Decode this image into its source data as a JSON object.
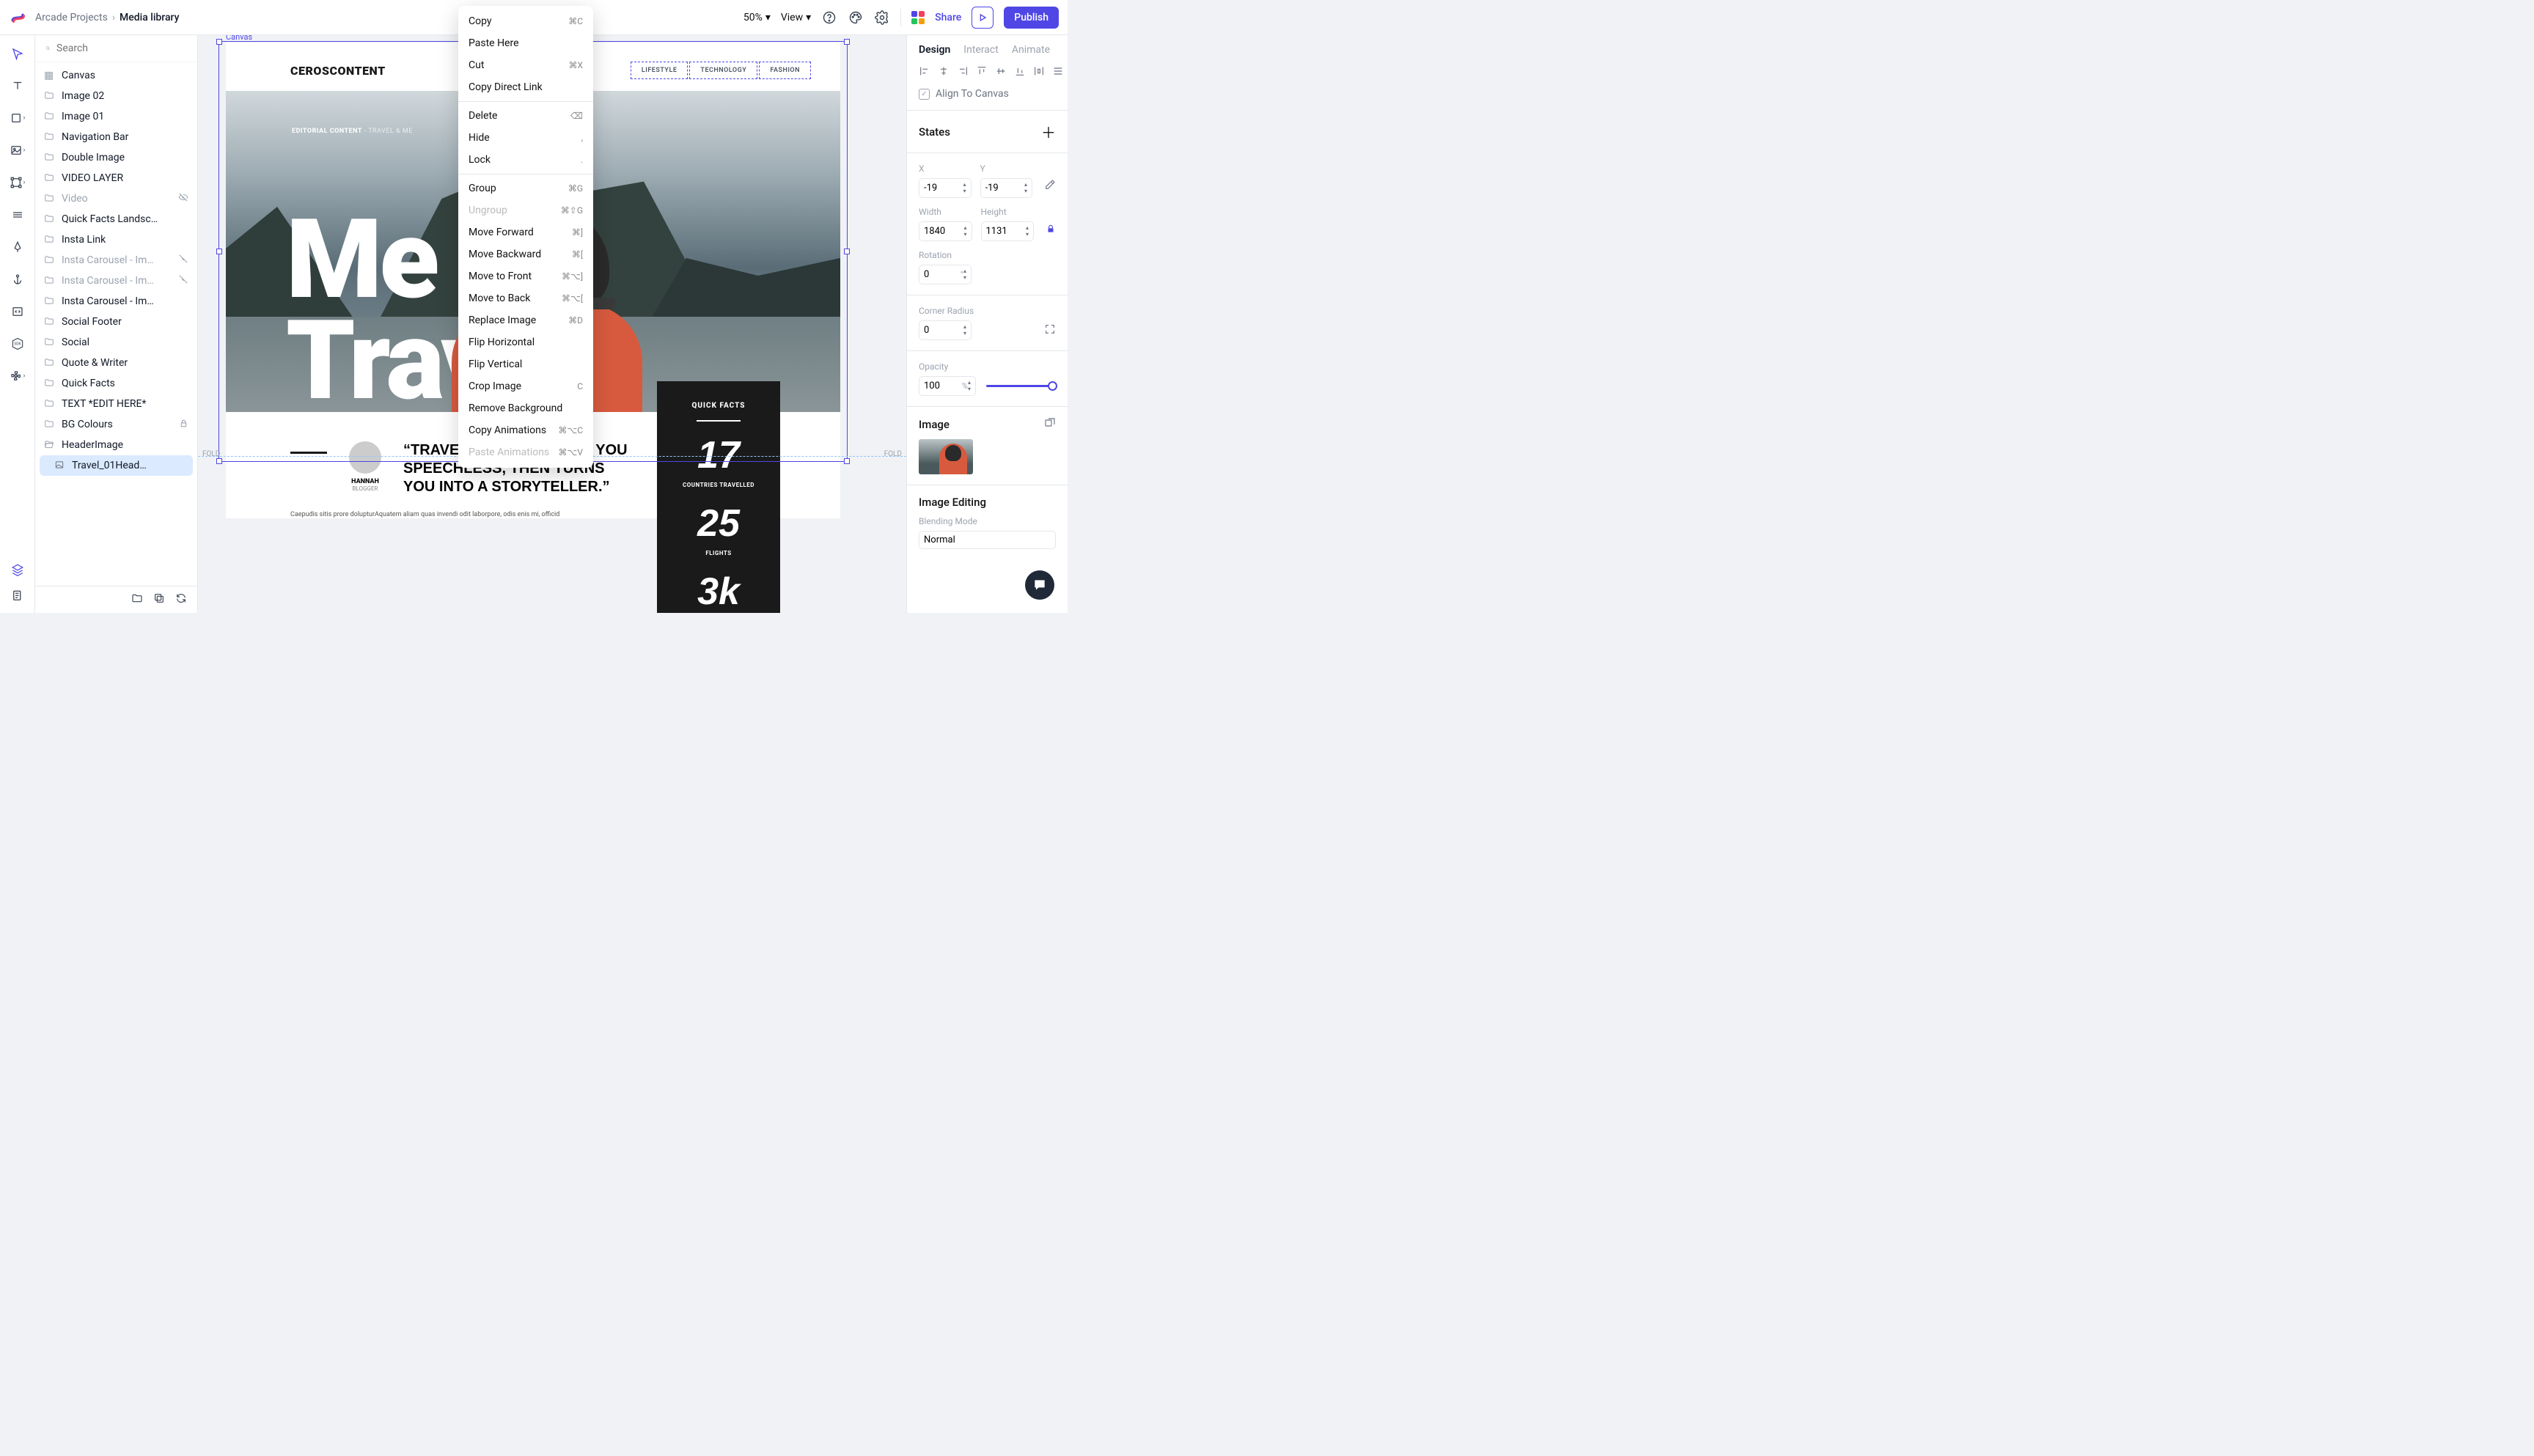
{
  "breadcrumb": {
    "parent": "Arcade Projects",
    "current": "Media library"
  },
  "top": {
    "zoom": "50%",
    "view": "View",
    "share": "Share",
    "publish": "Publish"
  },
  "search": {
    "placeholder": "Search"
  },
  "layers": {
    "canvas": "Canvas",
    "items": [
      {
        "label": "Image 02"
      },
      {
        "label": "Image 01"
      },
      {
        "label": "Navigation Bar"
      },
      {
        "label": "Double Image"
      },
      {
        "label": "VIDEO LAYER"
      },
      {
        "label": "Video",
        "dim": true,
        "hidden": true
      },
      {
        "label": "Quick Facts Landsc…"
      },
      {
        "label": "Insta Link"
      },
      {
        "label": "Insta Carousel - Im…",
        "dim": true,
        "hidden": true
      },
      {
        "label": "Insta Carousel - Im…",
        "dim": true,
        "hidden": true
      },
      {
        "label": "Insta Carousel - Im…"
      },
      {
        "label": "Social Footer"
      },
      {
        "label": "Social"
      },
      {
        "label": "Quote & Writer"
      },
      {
        "label": "Quick Facts"
      },
      {
        "label": "TEXT *EDIT HERE*"
      },
      {
        "label": "BG Colours",
        "locked": true
      },
      {
        "label": "HeaderImage",
        "open": true
      }
    ],
    "selected": "Travel_01Head…"
  },
  "artboard": {
    "label": "Canvas",
    "brand": "CEROSCONTENT",
    "nav": [
      "LIFESTYLE",
      "TECHNOLOGY",
      "FASHION"
    ],
    "editorial": {
      "main": "EDITORIAL CONTENT",
      "sub": " - TRAVEL & ME"
    },
    "title": {
      "l1": "Me &",
      "l2": "Travel"
    },
    "quick": {
      "title": "QUICK FACTS",
      "n1": "17",
      "l1": "COUNTRIES TRAVELLED",
      "n2": "25",
      "l2": "FLIGHTS",
      "n3": "3k"
    },
    "author": {
      "name": "HANNAH",
      "role": "BLOGGER"
    },
    "quote": "“TRAVELING — IT LEAVES YOU SPEECHLESS, THEN TURNS YOU INTO A STORYTELLER.”",
    "lorem": "Caepudis sitis prore dolupturAquatem aliam quas invendi odit laborpore, odis enis mi, officid",
    "fold": "FOLD"
  },
  "ctx": {
    "copy": "Copy",
    "copy_sc": "⌘C",
    "pasteHere": "Paste Here",
    "cut": "Cut",
    "cut_sc": "⌘X",
    "copyLink": "Copy Direct Link",
    "delete": "Delete",
    "hide": "Hide",
    "hide_sc": ",",
    "lock": "Lock",
    "lock_sc": ".",
    "group": "Group",
    "group_sc": "⌘G",
    "ungroup": "Ungroup",
    "ungroup_sc": "⌘⇧G",
    "mfwd": "Move Forward",
    "mfwd_sc": "⌘]",
    "mback": "Move Backward",
    "mback_sc": "⌘[",
    "mfront": "Move to Front",
    "mfront_sc": "⌘⌥]",
    "mbk": "Move to Back",
    "mbk_sc": "⌘⌥[",
    "rimg": "Replace Image",
    "rimg_sc": "⌘D",
    "fliph": "Flip Horizontal",
    "flipv": "Flip Vertical",
    "crop": "Crop Image",
    "crop_sc": "C",
    "rmbg": "Remove Background",
    "canim": "Copy Animations",
    "canim_sc": "⌘⌥C",
    "panim": "Paste Animations",
    "panim_sc": "⌘⌥V"
  },
  "rp": {
    "tabs": {
      "design": "Design",
      "interact": "Interact",
      "animate": "Animate"
    },
    "alignCanvas": "Align To Canvas",
    "states": "States",
    "xLabel": "X",
    "yLabel": "Y",
    "x": "-19",
    "y": "-19",
    "wLabel": "Width",
    "hLabel": "Height",
    "w": "1840",
    "h": "1131",
    "rotLabel": "Rotation",
    "rot": "0",
    "rotUnit": "°",
    "crLabel": "Corner Radius",
    "cr": "0",
    "opLabel": "Opacity",
    "op": "100",
    "opUnit": "%",
    "imgLabel": "Image",
    "editLabel": "Image Editing",
    "blendLabel": "Blending Mode",
    "blend": "Normal"
  }
}
